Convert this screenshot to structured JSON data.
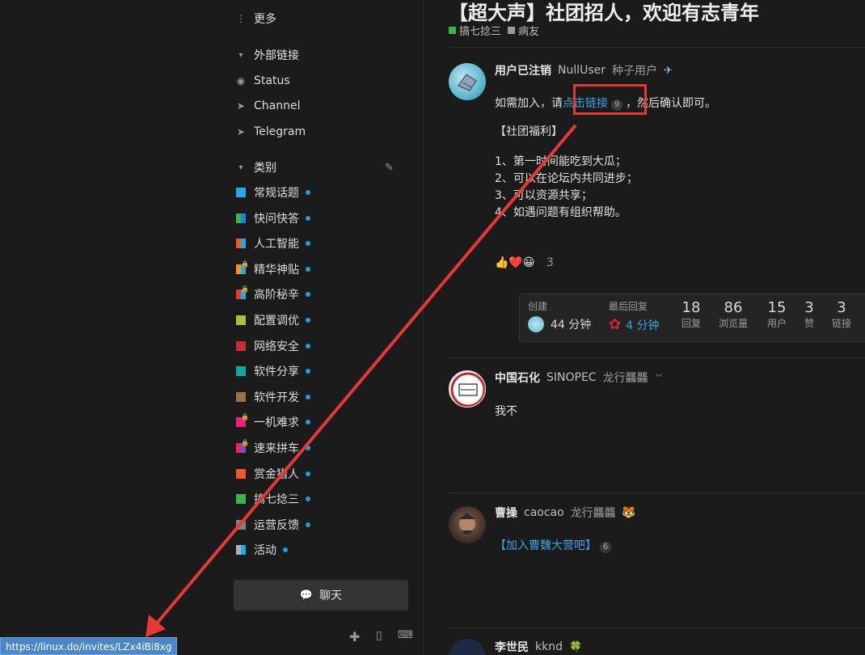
{
  "sidebar": {
    "more_label": "更多",
    "external_links_header": "外部链接",
    "external_links": [
      {
        "label": "Status",
        "icon": "eye-icon"
      },
      {
        "label": "Channel",
        "icon": "send-icon"
      },
      {
        "label": "Telegram",
        "icon": "send-icon"
      }
    ],
    "categories_header": "类别",
    "categories": [
      {
        "label": "常规话题",
        "colors": [
          "#25aae1",
          "#25aae1"
        ],
        "locked": false
      },
      {
        "label": "快问快答",
        "colors": [
          "#3ab54a",
          "#2185d0"
        ],
        "locked": false
      },
      {
        "label": "人工智能",
        "colors": [
          "#f15a24",
          "#25aae1"
        ],
        "locked": false
      },
      {
        "label": "精华神贴",
        "colors": [
          "#f7941d",
          "#25aae1"
        ],
        "locked": true
      },
      {
        "label": "高阶秘辛",
        "colors": [
          "#e53935",
          "#25aae1"
        ],
        "locked": true
      },
      {
        "label": "配置调优",
        "colors": [
          "#a3c23d",
          "#a3c23d"
        ],
        "locked": false
      },
      {
        "label": "网络安全",
        "colors": [
          "#c62f34",
          "#c62f34"
        ],
        "locked": false
      },
      {
        "label": "软件分享",
        "colors": [
          "#12a89d",
          "#12a89d"
        ],
        "locked": false
      },
      {
        "label": "软件开发",
        "colors": [
          "#9c6f45",
          "#9c6f45"
        ],
        "locked": false
      },
      {
        "label": "一机难求",
        "colors": [
          "#ed207b",
          "#ed207b"
        ],
        "locked": true
      },
      {
        "label": "速来拼车",
        "colors": [
          "#ed207b",
          "#7b4fb8"
        ],
        "locked": true
      },
      {
        "label": "赏金猎人",
        "colors": [
          "#f15a24",
          "#f15a24"
        ],
        "locked": false
      },
      {
        "label": "搞七捻三",
        "colors": [
          "#3ab54a",
          "#3ab54a"
        ],
        "locked": false
      },
      {
        "label": "运营反馈",
        "colors": [
          "#808281",
          "#808281"
        ],
        "locked": false
      },
      {
        "label": "活动",
        "colors": [
          "#b0b0b0",
          "#25aae1"
        ],
        "locked": false
      }
    ],
    "chat_label": "聊天"
  },
  "topic": {
    "title": "【超大声】社团招人，欢迎有志青年",
    "tags": [
      {
        "label": "搞七捻三",
        "color": "#3ab54a"
      },
      {
        "label": "病友",
        "color": "#9a9a9a"
      }
    ]
  },
  "posts": [
    {
      "username": "用户已注销",
      "handle": "NullUser",
      "title": "种子用户",
      "flair": "✈",
      "line1_prefix": "如需加入，请",
      "line1_link": "点击链接",
      "line1_badge": "9",
      "line1_suffix": "，然后确认即可。",
      "benefits_header": "【社团福利】",
      "benefits": [
        "1、第一时间能吃到大瓜；",
        "2、可以在论坛内共同进步；",
        "3、可以资源共享；",
        "4、如遇问题有组织帮助。"
      ],
      "reactions": "👍❤️😀",
      "reaction_count": "3",
      "stats": {
        "created_label": "创建",
        "created_value": "44 分钟",
        "last_reply_label": "最后回复",
        "last_reply_value": "4 分钟",
        "replies_value": "18",
        "replies_label": "回复",
        "views_value": "86",
        "views_label": "浏览量",
        "users_value": "15",
        "users_label": "用户",
        "likes_value": "3",
        "likes_label": "赞",
        "links_value": "3",
        "links_label": "链接"
      }
    },
    {
      "username": "中国石化",
      "handle": "SINOPEC",
      "title": "龙行龘龘",
      "flair": "™",
      "text": "我不"
    },
    {
      "username": "曹操",
      "handle": "caocao",
      "title": "龙行龘龘",
      "flair": "🐯",
      "link_text": "【加入曹魏大营吧】",
      "badge": "6"
    },
    {
      "username": "李世民",
      "handle": "kknd",
      "flair": "🍀"
    }
  ],
  "statusbar": {
    "url": "https://linux.do/invites/LZx4iBi8xg"
  }
}
